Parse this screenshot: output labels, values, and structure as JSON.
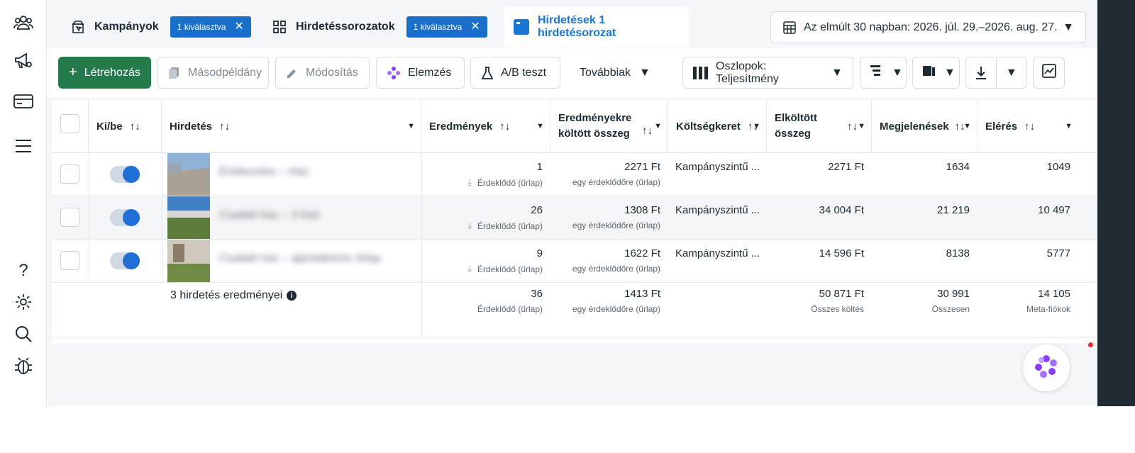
{
  "rail": {
    "icons": [
      "people-icon",
      "megaphone-icon",
      "card-icon",
      "menu-icon",
      "help-icon",
      "gear-icon",
      "search-icon",
      "bug-icon"
    ]
  },
  "tabs": [
    {
      "label": "Kampányok",
      "chip": "1 kiválasztva"
    },
    {
      "label": "Hirdetéssorozatok",
      "chip": "1 kiválasztva"
    },
    {
      "label": "Hirdetések 1 hirdetésorozat",
      "chip": ""
    }
  ],
  "date_range": "Az elmúlt 30 napban: 2026. júl. 29.–2026. aug. 27.",
  "toolbar": {
    "create": "Létrehozás",
    "duplicate": "Másodpéldány",
    "edit": "Módosítás",
    "analyze": "Elemzés",
    "ab_test": "A/B teszt",
    "more": "Továbbiak",
    "columns": "Oszlopok: Teljesítmény"
  },
  "headers": {
    "onoff": "Ki/be",
    "ad": "Hirdetés",
    "results": "Eredmények",
    "cost_per_result": "Eredményekre költött összeg",
    "budget": "Költségkeret",
    "spent": "Elköltött összeg",
    "impressions": "Megjelenések",
    "reach": "Elérés"
  },
  "rows": [
    {
      "name": "Értékesítés – Ház",
      "results": "1",
      "results_sub": "Érdeklődő (űrlap)",
      "cpr": "2271 Ft",
      "cpr_sub": "egy érdeklődőre (űrlap)",
      "budget": "Kampányszintű ...",
      "spent": "2271 Ft",
      "impressions": "1634",
      "reach": "1049",
      "toggle_on": true
    },
    {
      "name": "Családi ház – 3 fotó",
      "results": "26",
      "results_sub": "Érdeklődő (űrlap)",
      "cpr": "1308 Ft",
      "cpr_sub": "egy érdeklődőre (űrlap)",
      "budget": "Kampányszintű ...",
      "spent": "34 004 Ft",
      "impressions": "21 219",
      "reach": "10 497",
      "toggle_on": true
    },
    {
      "name": "Családi ház – ajánlatkérés űrlap",
      "results": "9",
      "results_sub": "Érdeklődő (űrlap)",
      "cpr": "1622 Ft",
      "cpr_sub": "egy érdeklődőre (űrlap)",
      "budget": "Kampányszintű ...",
      "spent": "14 596 Ft",
      "impressions": "8138",
      "reach": "5777",
      "toggle_on": true
    }
  ],
  "summary": {
    "label": "3 hirdetés eredményei",
    "results": "36",
    "results_sub": "Érdeklődő (űrlap)",
    "cpr": "1413 Ft",
    "cpr_sub": "egy érdeklődőre (űrlap)",
    "spent": "50 871 Ft",
    "spent_sub": "Összes költés",
    "impressions": "30 991",
    "impressions_sub": "Összesen",
    "reach": "14 105",
    "reach_sub": "Meta-fiókok"
  },
  "colors": {
    "primary_green": "#257a4b",
    "chip_blue": "#1a6fc9",
    "active_tab_text": "#1876d2",
    "toggle_knob": "#1f6fd6"
  }
}
